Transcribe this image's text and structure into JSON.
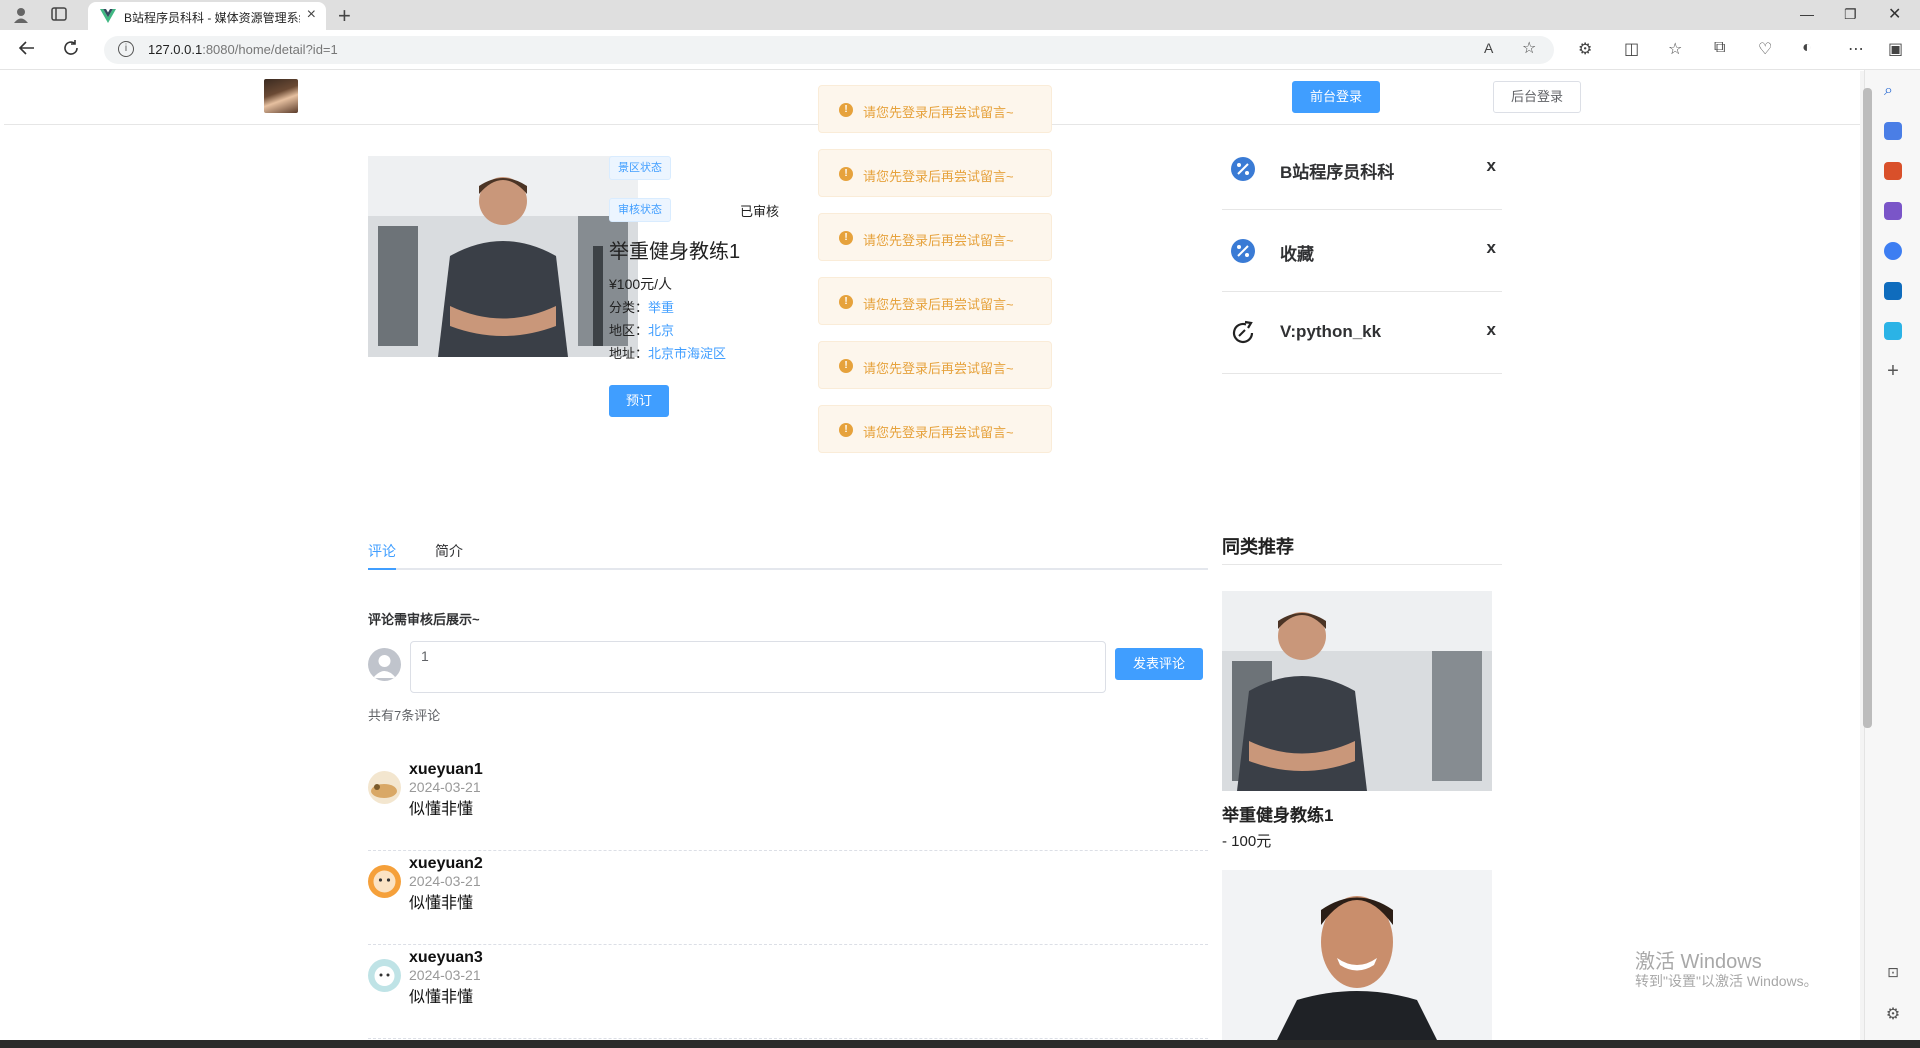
{
  "browser": {
    "tab_title": "B站程序员科科 - 媒体资源管理系统",
    "url_host": "127.0.0.1",
    "url_rest": ":8080/home/detail?id=1"
  },
  "header": {
    "front_login": "前台登录",
    "back_login": "后台登录"
  },
  "product": {
    "tag_scenic": "景区状态",
    "tag_review": "审核状态",
    "review_status": "已审核",
    "title": "举重健身教练1",
    "price": "¥100元/人",
    "category_label": "分类：",
    "category": "举重",
    "region_label": "地区：",
    "region": "北京",
    "address_label": "地址：",
    "address": "北京市海淀区",
    "book_button": "预订"
  },
  "toasts": [
    "请您先登录后再尝试留言~",
    "请您先登录后再尝试留言~",
    "请您先登录后再尝试留言~",
    "请您先登录后再尝试留言~",
    "请您先登录后再尝试留言~",
    "请您先登录后再尝试留言~"
  ],
  "side_links": [
    {
      "label": "B站程序员科科",
      "close": "x"
    },
    {
      "label": "收藏",
      "close": "x"
    },
    {
      "label": "V:python_kk",
      "close": "x"
    }
  ],
  "tabs": [
    "评论",
    "简介"
  ],
  "comments_section": {
    "notice": "评论需审核后展示~",
    "input_value": "1",
    "submit": "发表评论",
    "count_text": "共有7条评论",
    "items": [
      {
        "name": "xueyuan1",
        "date": "2024-03-21",
        "text": "似懂非懂"
      },
      {
        "name": "xueyuan2",
        "date": "2024-03-21",
        "text": "似懂非懂"
      },
      {
        "name": "xueyuan3",
        "date": "2024-03-21",
        "text": "似懂非懂"
      }
    ]
  },
  "recommend": {
    "title": "同类推荐",
    "items": [
      {
        "name": "举重健身教练1",
        "price": "- 100元"
      }
    ]
  },
  "watermark": {
    "line1": "激活 Windows",
    "line2": "转到\"设置\"以激活 Windows。"
  }
}
